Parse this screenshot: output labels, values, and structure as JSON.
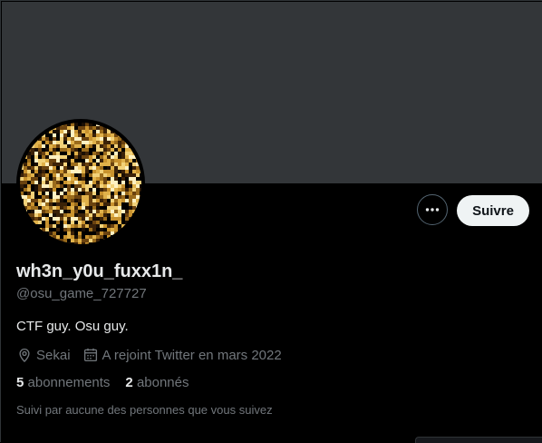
{
  "profile": {
    "display_name": "wh3n_y0u_fuxx1n_",
    "handle": "@osu_game_727727",
    "bio": "CTF guy. Osu guy.",
    "location": "Sekai",
    "joined": "A rejoint Twitter en mars 2022",
    "following_count": "5",
    "following_label": "abonnements",
    "followers_count": "2",
    "followers_label": "abonnés",
    "followed_by_text": "Suivi par aucune des personnes que vous suivez"
  },
  "actions": {
    "more_icon": "more-horizontal-icon",
    "follow_label": "Suivre"
  },
  "icons": {
    "location": "location-pin-icon",
    "joined": "calendar-icon"
  },
  "colors": {
    "background": "#000000",
    "banner": "#333639",
    "primary_text": "#e7e9ea",
    "secondary_text": "#71767b",
    "follow_button_bg": "#eff3f4",
    "follow_button_text": "#0f1419"
  }
}
